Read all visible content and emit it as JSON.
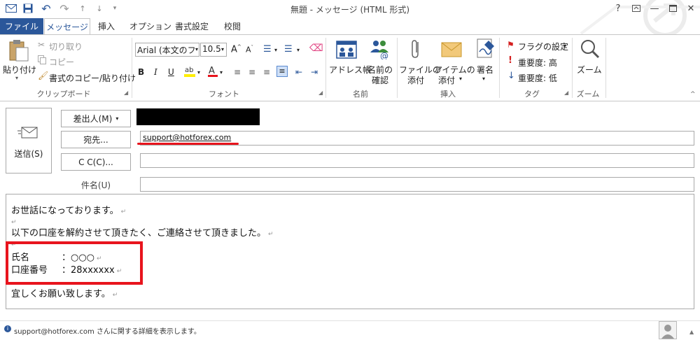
{
  "window": {
    "title": "無題 - メッセージ (HTML 形式)",
    "help": "?",
    "minimize": "—",
    "close": "✕"
  },
  "tabs": [
    "ファイル",
    "メッセージ",
    "挿入",
    "オプション",
    "書式設定",
    "校閲"
  ],
  "ribbon": {
    "clipboard": {
      "paste": "貼り付け",
      "cut": "切り取り",
      "copy": "コピー",
      "format_painter": "書式のコピー/貼り付け",
      "label": "クリップボード"
    },
    "font": {
      "font_name": "Arial (本文のフ",
      "font_size": "10.5",
      "label": "フォント"
    },
    "names": {
      "address_book": "アドレス帳",
      "check_names_1": "名前の",
      "check_names_2": "確認",
      "label": "名前"
    },
    "insert": {
      "attach_file_1": "ファイルの",
      "attach_file_2": "添付",
      "attach_item_1": "アイテムの",
      "attach_item_2": "添付",
      "signature": "署名",
      "label": "挿入"
    },
    "tags": {
      "follow_up": "フラグの設定",
      "high": "重要度: 高",
      "low": "重要度: 低",
      "label": "タグ"
    },
    "zoom": {
      "zoom": "ズーム",
      "label": "ズーム"
    }
  },
  "compose": {
    "send": "送信(S)",
    "from": "差出人(M)",
    "to_button": "宛先...",
    "to_value": "support@hotforex.com",
    "cc_button": "C C(C)...",
    "subject_label": "件名(U)"
  },
  "body": {
    "line1": "お世話になっております。",
    "line2": "以下の口座を解約させて頂きたく、ご連絡させて頂きました。",
    "name_label": "氏名",
    "name_value": "：○○○",
    "account_label": "口座番号",
    "account_value": "：28xxxxxx",
    "line_closing": "宜しくお願い致します。"
  },
  "status": {
    "info": "support@hotforex.com さんに関する詳細を表示します。"
  },
  "colors": {
    "accent": "#2b579a",
    "highlight_red": "#e8141d",
    "redacted": "#000000"
  }
}
